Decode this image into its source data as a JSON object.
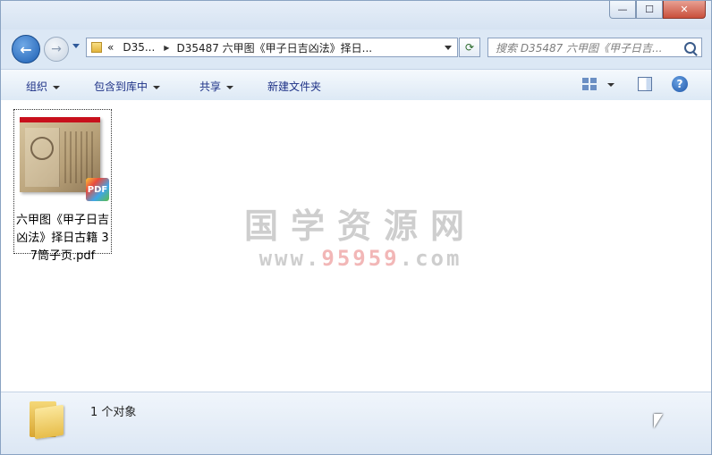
{
  "window": {
    "minimize_glyph": "—",
    "maximize_glyph": "☐",
    "close_glyph": "✕"
  },
  "navigation": {
    "back_glyph": "←",
    "forward_glyph": "→",
    "refresh_glyph": "⟳"
  },
  "address": {
    "overflow_glyph": "«",
    "crumbs": [
      "D35...",
      "D35487 六甲图《甲子日吉凶法》择日..."
    ],
    "sep_glyph": "▶"
  },
  "search": {
    "placeholder": "搜索 D35487 六甲图《甲子日吉..."
  },
  "toolbar": {
    "organize": "组织",
    "include_library": "包含到库中",
    "share": "共享",
    "new_folder": "新建文件夹",
    "help_glyph": "?"
  },
  "files": [
    {
      "name": "六甲图《甲子日吉凶法》择日古籍 37筒子页.pdf",
      "badge": "PDF",
      "thumb_header": "PDF"
    }
  ],
  "watermark": {
    "text_cn": "国学资源网",
    "url_prefix": "www.",
    "url_number": "95959",
    "url_suffix": ".com"
  },
  "status": {
    "count_text": "1 个对象"
  },
  "colors": {
    "accent": "#1e3287",
    "close": "#c9503c",
    "folder": "#e7bd4a"
  },
  "icons": [
    "back-arrow-icon",
    "forward-arrow-icon",
    "folder-icon",
    "refresh-icon",
    "search-icon",
    "view-options-icon",
    "preview-pane-icon",
    "help-icon",
    "pdf-icon"
  ]
}
